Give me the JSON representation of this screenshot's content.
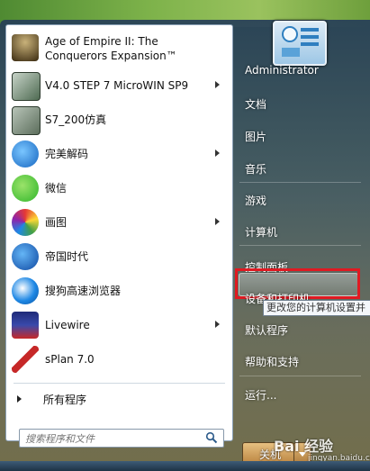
{
  "programs": [
    {
      "label": "Age of Empire II: The Conquerors Expansion™",
      "icon": "aoe-icon",
      "has_submenu": false
    },
    {
      "label": "V4.0 STEP 7 MicroWIN SP9",
      "icon": "microwin-icon",
      "has_submenu": true
    },
    {
      "label": "S7_200仿真",
      "icon": "s7-simulator-icon",
      "has_submenu": false
    },
    {
      "label": "完美解码",
      "icon": "potplayer-icon",
      "has_submenu": true
    },
    {
      "label": "微信",
      "icon": "wechat-icon",
      "has_submenu": false
    },
    {
      "label": "画图",
      "icon": "paint-icon",
      "has_submenu": true
    },
    {
      "label": "帝国时代",
      "icon": "aoe-globe-icon",
      "has_submenu": false
    },
    {
      "label": "搜狗高速浏览器",
      "icon": "sogou-icon",
      "has_submenu": false
    },
    {
      "label": "Livewire",
      "icon": "livewire-icon",
      "has_submenu": true
    },
    {
      "label": "sPlan 7.0",
      "icon": "splan-icon",
      "has_submenu": false
    }
  ],
  "all_programs_label": "所有程序",
  "search": {
    "placeholder": "搜索程序和文件"
  },
  "right_pane": {
    "items": [
      {
        "label": "Administrator"
      },
      {
        "label": "文档"
      },
      {
        "label": "图片"
      },
      {
        "label": "音乐"
      },
      {
        "label": "游戏"
      },
      {
        "label": "计算机"
      },
      {
        "label": "控制面板"
      },
      {
        "label": "设备和打印机"
      },
      {
        "label": "默认程序"
      },
      {
        "label": "帮助和支持"
      },
      {
        "label": "运行..."
      }
    ]
  },
  "tooltip": "更改您的计算机设置并",
  "shutdown_label": "关机",
  "watermark": {
    "line1": "Bai 经验",
    "line2": "jingyan.baidu.com"
  },
  "colors": {
    "highlight_border": "#e01a22"
  }
}
